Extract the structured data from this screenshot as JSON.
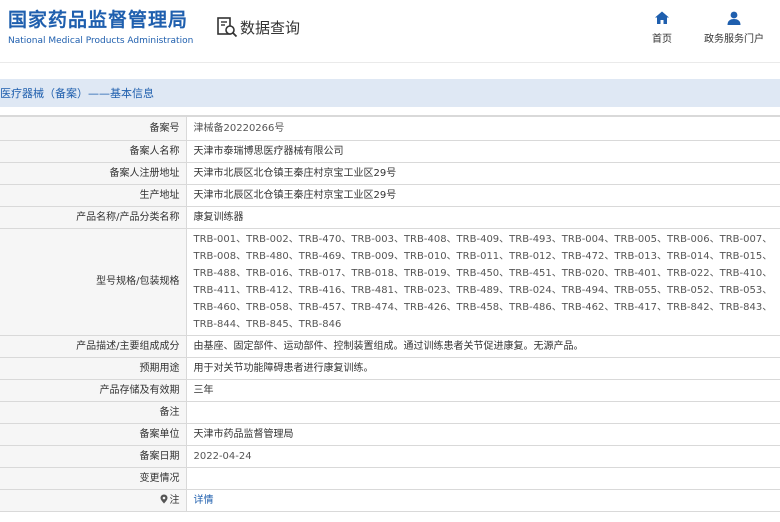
{
  "header": {
    "logo_cn": "国家药品监督管理局",
    "logo_en": "National Medical Products Administration",
    "query_icon": "document-search-icon",
    "query_label": "数据查询",
    "nav": {
      "home": {
        "icon": "home-icon",
        "label": "首页"
      },
      "gov": {
        "icon": "user-icon",
        "label": "政务服务门户"
      }
    }
  },
  "breadcrumb": "医疗器械（备案）——基本信息",
  "colors": {
    "brand": "#1f5fae",
    "bar": "#dfe8f4",
    "label_bg": "#f6f6f6",
    "border": "#d9d9d9"
  },
  "rows": [
    {
      "label": "备案号",
      "value": "津械备20220266号"
    },
    {
      "label": "备案人名称",
      "value": "天津市泰瑞博思医疗器械有限公司"
    },
    {
      "label": "备案人注册地址",
      "value": "天津市北辰区北仓镇王秦庄村京宝工业区29号"
    },
    {
      "label": "生产地址",
      "value": "天津市北辰区北仓镇王秦庄村京宝工业区29号"
    },
    {
      "label": "产品名称/产品分类名称",
      "value": "康复训练器"
    },
    {
      "label": "型号规格/包装规格",
      "value": "TRB-001、TRB-002、TRB-470、TRB-003、TRB-408、TRB-409、TRB-493、TRB-004、TRB-005、TRB-006、TRB-007、TRB-008、TRB-480、TRB-469、TRB-009、TRB-010、TRB-011、TRB-012、TRB-472、TRB-013、TRB-014、TRB-015、TRB-488、TRB-016、TRB-017、TRB-018、TRB-019、TRB-450、TRB-451、TRB-020、TRB-401、TRB-022、TRB-410、TRB-411、TRB-412、TRB-416、TRB-481、TRB-023、TRB-489、TRB-024、TRB-494、TRB-055、TRB-052、TRB-053、TRB-460、TRB-058、TRB-457、TRB-474、TRB-426、TRB-458、TRB-486、TRB-462、TRB-417、TRB-842、TRB-843、TRB-844、TRB-845、TRB-846"
    },
    {
      "label": "产品描述/主要组成成分",
      "value": "由基座、固定部件、运动部件、控制装置组成。通过训练患者关节促进康复。无源产品。"
    },
    {
      "label": "预期用途",
      "value": "用于对关节功能障碍患者进行康复训练。"
    },
    {
      "label": "产品存储及有效期",
      "value": "三年"
    },
    {
      "label": "备注",
      "value": ""
    },
    {
      "label": "备案单位",
      "value": "天津市药品监督管理局"
    },
    {
      "label": "备案日期",
      "value": "2022-04-24"
    },
    {
      "label": "变更情况",
      "value": ""
    },
    {
      "label": "注",
      "value": "详情",
      "icon": "pin-icon"
    }
  ]
}
